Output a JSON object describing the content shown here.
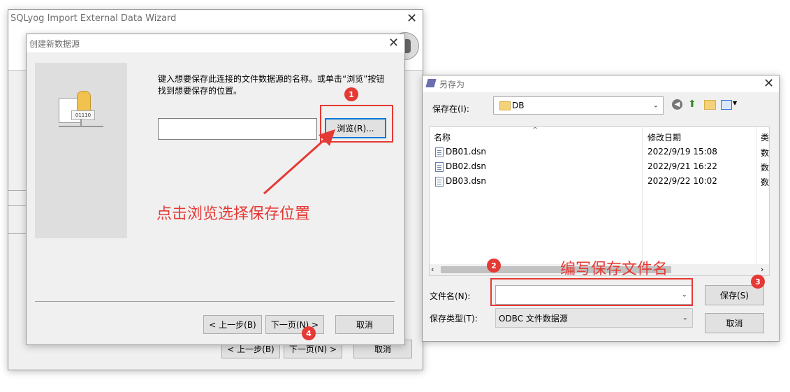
{
  "main_wizard": {
    "title": "SQLyog Import External Data Wizard",
    "back_label": "< 上一步(B)",
    "next_label": "下一页(N) >",
    "cancel_label": "取消"
  },
  "create_dsn_dialog": {
    "title": "创建新数据源",
    "instruction": "键入想要保存此连接的文件数据源的名称。或单击“浏览”按钮找到想要保存的位置。",
    "name_value": "",
    "browse_label": "浏览(R)...",
    "back_label": "< 上一步(B)",
    "next_label": "下一页(N) >",
    "cancel_label": "取消",
    "illustration_text": "01110"
  },
  "save_as_dialog": {
    "title": "另存为",
    "save_in_label": "保存在(I):",
    "save_in_value": "DB",
    "columns": {
      "name": "名称",
      "modified": "修改日期",
      "type": "类"
    },
    "files": [
      {
        "name": "DB01.dsn",
        "modified": "2022/9/19 15:08",
        "type": "数"
      },
      {
        "name": "DB02.dsn",
        "modified": "2022/9/21 16:22",
        "type": "数"
      },
      {
        "name": "DB03.dsn",
        "modified": "2022/9/22 10:02",
        "type": "数"
      }
    ],
    "filename_label": "文件名(N):",
    "filename_value": "",
    "filetype_label": "保存类型(T):",
    "filetype_value": "ODBC 文件数据源",
    "save_label": "保存(S)",
    "cancel_label": "取消"
  },
  "annotations": {
    "badge1": "1",
    "badge2": "2",
    "badge3": "3",
    "badge4": "4",
    "browse_hint": "点击浏览选择保存位置",
    "filename_hint": "编写保存文件名"
  },
  "colors": {
    "annotation_red": "#e53935",
    "dialog_bg": "#f0f0f0",
    "focus_blue": "#0078d7"
  }
}
